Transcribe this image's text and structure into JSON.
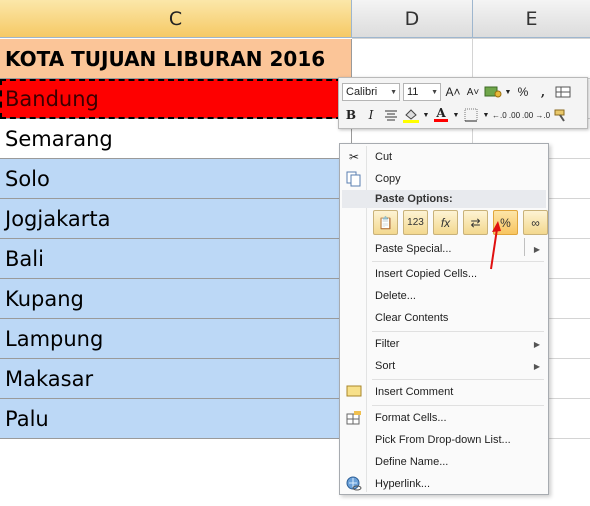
{
  "columns": [
    "C",
    "D",
    "E"
  ],
  "cells": [
    {
      "text": "KOTA TUJUAN LIBURAN 2016",
      "style": "title"
    },
    {
      "text": "Bandung",
      "style": "red"
    },
    {
      "text": "Semarang",
      "style": "white"
    },
    {
      "text": "Solo",
      "style": "blue"
    },
    {
      "text": "Jogjakarta",
      "style": "blue"
    },
    {
      "text": "Bali",
      "style": "blue"
    },
    {
      "text": "Kupang",
      "style": "blue"
    },
    {
      "text": "Lampung",
      "style": "blue"
    },
    {
      "text": "Makasar",
      "style": "blue"
    },
    {
      "text": "Palu",
      "style": "blue"
    }
  ],
  "mini_toolbar": {
    "font_name": "Calibri",
    "font_size": "11",
    "grow_font": "A˄",
    "shrink_font": "A˅",
    "percent": "%",
    "comma": ",",
    "bold": "B",
    "italic": "I",
    "font_color_glyph": "A",
    "fill_color": "#ffff00",
    "font_color": "#ff0000",
    "inc_decimal": "←.0 .00",
    "dec_decimal": ".00 →.0"
  },
  "context_menu": {
    "cut": "Cut",
    "copy": "Copy",
    "paste_options_header": "Paste Options:",
    "paste_options": [
      {
        "icon": "paste-icon",
        "glyph": "📋"
      },
      {
        "icon": "values-icon",
        "glyph": "123"
      },
      {
        "icon": "formulas-icon",
        "glyph": "fx"
      },
      {
        "icon": "transpose-icon",
        "glyph": "⇄"
      },
      {
        "icon": "formatting-icon",
        "glyph": "%"
      },
      {
        "icon": "paste-link-icon",
        "glyph": "∞"
      }
    ],
    "selected_paste_option": "formatting-icon",
    "paste_special": "Paste Special...",
    "insert_copied_cells": "Insert Copied Cells...",
    "delete": "Delete...",
    "clear_contents": "Clear Contents",
    "filter": "Filter",
    "sort": "Sort",
    "insert_comment": "Insert Comment",
    "format_cells": "Format Cells...",
    "pick_from_dropdown": "Pick From Drop-down List...",
    "define_name": "Define Name...",
    "hyperlink": "Hyperlink..."
  },
  "annotation_color": "#e01010"
}
